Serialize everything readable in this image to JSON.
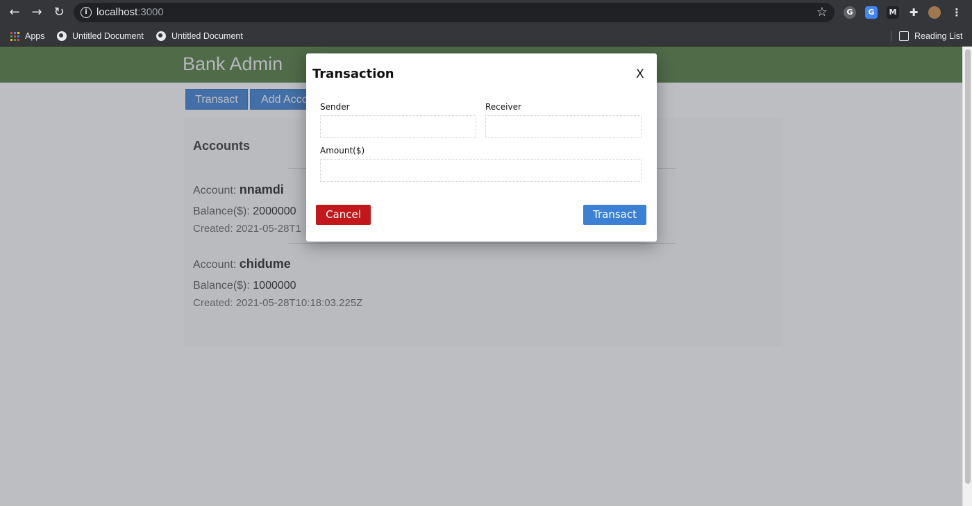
{
  "browser": {
    "back_icon": "arrow-left-icon",
    "forward_icon": "arrow-right-icon",
    "reload_icon": "reload-icon",
    "url_host": "localhost",
    "url_port": ":3000",
    "bookmark_star_icon": "star-icon",
    "bookmarks": [
      {
        "label": "Apps",
        "icon": "apps-grid-icon"
      },
      {
        "label": "Untitled Document",
        "icon": "globe-icon"
      },
      {
        "label": "Untitled Document",
        "icon": "globe-icon"
      }
    ],
    "reading_list": "Reading List",
    "extensions": [
      "grammarly-icon",
      "translate-icon",
      "extension-m-icon",
      "puzzle-icon",
      "avatar-icon",
      "kebab-menu-icon"
    ]
  },
  "app": {
    "brand": "Bank Admin",
    "header_color": "#4f7a3a",
    "tabs": {
      "transact": "Transact",
      "add_account": "Add Acco"
    },
    "accounts_title": "Accounts",
    "accounts": [
      {
        "label": "Account: ",
        "name": "nnamdi",
        "balance_label": "Balance($): ",
        "balance": "2000000",
        "created": "Created: 2021-05-28T1"
      },
      {
        "label": "Account: ",
        "name": "chidume",
        "balance_label": "Balance($): ",
        "balance": "1000000",
        "created": "Created: 2021-05-28T10:18:03.225Z"
      }
    ]
  },
  "modal": {
    "title": "Transaction",
    "close": "X",
    "sender_label": "Sender",
    "sender_value": "",
    "receiver_label": "Receiver",
    "receiver_value": "",
    "amount_label": "Amount($)",
    "amount_value": "",
    "cancel": "Cancel",
    "transact": "Transact",
    "cancel_color": "#c3181b",
    "transact_color": "#3b80d4"
  }
}
